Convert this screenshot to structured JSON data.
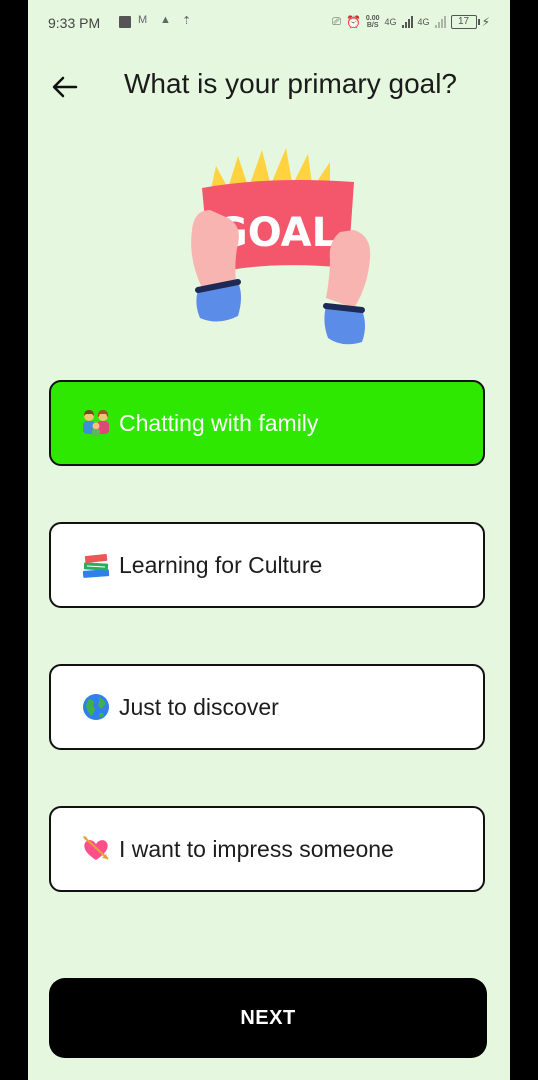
{
  "status_bar": {
    "time": "9:33 PM",
    "net_speed_value": "0.00",
    "net_speed_unit": "B/S",
    "network_1": "4G",
    "network_2": "4G",
    "battery_level": "17"
  },
  "header": {
    "title": "What is your primary goal?",
    "back_icon": "arrow-left-icon"
  },
  "illustration": {
    "banner_text": "GOAL"
  },
  "options": [
    {
      "emoji": "family-icon",
      "label": "Chatting with family",
      "selected": true
    },
    {
      "emoji": "books-icon",
      "label": "Learning for Culture",
      "selected": false
    },
    {
      "emoji": "globe-icon",
      "label": "Just to discover",
      "selected": false
    },
    {
      "emoji": "heart-with-arrow-icon",
      "label": "I want to impress someone",
      "selected": false
    }
  ],
  "next_button": {
    "label": "NEXT"
  },
  "colors": {
    "background": "#e5f7df",
    "selected_option": "#2ee801",
    "button": "#000000"
  }
}
